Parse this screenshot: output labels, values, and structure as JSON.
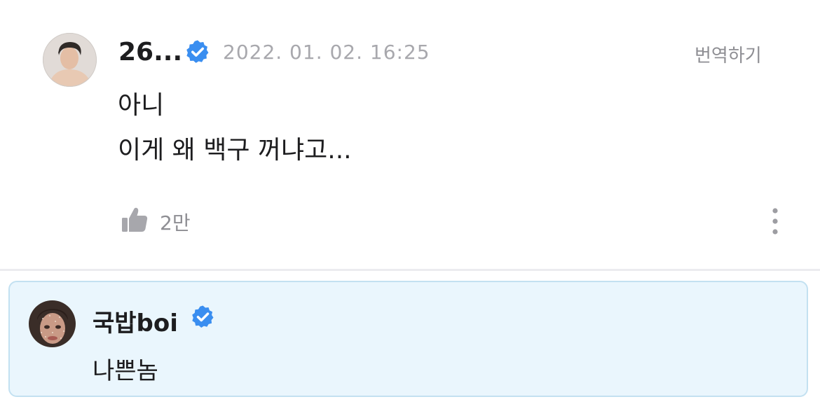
{
  "comment": {
    "author": "26...",
    "verified_icon": "verified-badge-icon",
    "timestamp": "2022. 01. 02. 16:25",
    "translate_label": "번역하기",
    "lines": [
      "아니",
      "이게 왜 백구 꺼냐고..."
    ],
    "like_icon": "thumbs-up-icon",
    "like_count": "2만",
    "more_icon": "more-vertical-icon"
  },
  "reply": {
    "author": "국밥boi",
    "verified_icon": "verified-badge-icon",
    "text": "나쁜놈"
  },
  "colors": {
    "verified_blue": "#3a8ef0",
    "reply_background": "#eaf6fd",
    "reply_border": "#c3e1f1",
    "muted_text": "#a8a8ad"
  }
}
